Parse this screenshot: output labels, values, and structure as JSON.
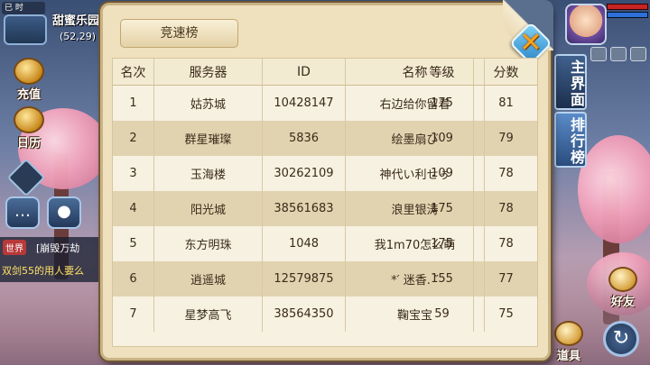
{
  "hud": {
    "time_label": "已 时",
    "map_name": "甜蜜乐园",
    "coords": "(52,29)"
  },
  "left_buttons": {
    "recharge": "充值",
    "calendar": "日历"
  },
  "chat": {
    "channel_tag": "世界",
    "line1": "[崩毁万劫",
    "line2": "双剑55的用人要么"
  },
  "side_tabs": {
    "main": "主界面",
    "ranking": "排行榜"
  },
  "right_buttons": {
    "friends": "好友",
    "items": "道具"
  },
  "panel": {
    "tab_label": "竞速榜",
    "columns": [
      "名次",
      "服务器",
      "ID",
      "名称",
      "等级",
      "分数"
    ],
    "rows": [
      [
        "1",
        "姑苏城",
        "10428147",
        "右边给你留着",
        "175",
        "81"
      ],
      [
        "2",
        "群星璀璨",
        "5836",
        "绘墨扇び",
        "109",
        "79"
      ],
      [
        "3",
        "玉海楼",
        "30262109",
        "神代い利せぅ",
        "109",
        "78"
      ],
      [
        "4",
        "阳光城",
        "38561683",
        "浪里银涛",
        "175",
        "78"
      ],
      [
        "5",
        "东方明珠",
        "1048",
        "我1m70怎么萌",
        "175",
        "78"
      ],
      [
        "6",
        "逍遥城",
        "12579875",
        "*′ 迷香. ″",
        "155",
        "77"
      ],
      [
        "7",
        "星梦高飞",
        "38564350",
        "鞠宝宝",
        "59",
        "75"
      ]
    ]
  }
}
